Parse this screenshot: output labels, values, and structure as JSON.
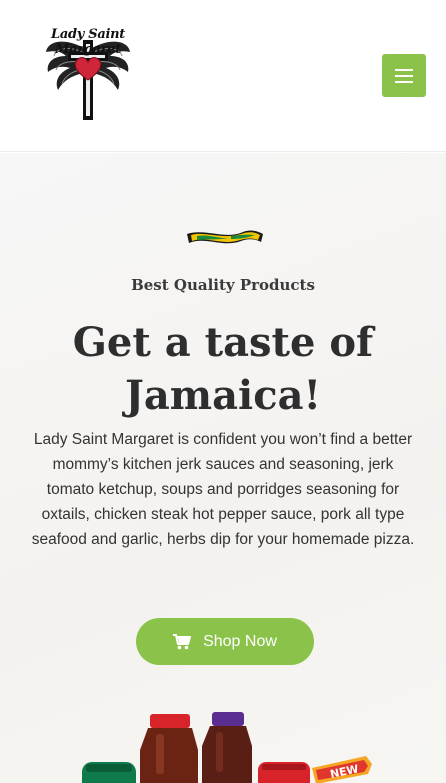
{
  "header": {
    "logo_text": "Lady Saint Margaret",
    "menu_icon": "hamburger-icon"
  },
  "hero": {
    "tagline": "Best Quality Products",
    "title_line1": "Get a taste of",
    "title_line2": "Jamaica!",
    "description": "Lady Saint Margaret is confident you won’t find a better mommy’s kitchen jerk sauces and seasoning, jerk tomato ketchup, soups and porridges seasoning for oxtails, chicken steak hot pepper sauce, pork all type seafood and garlic, herbs dip for your homemade pizza.",
    "cta_label": "Shop Now",
    "cta_icon": "shopping-cart-icon",
    "badge_text": "NEW"
  },
  "colors": {
    "accent": "#8bc34a",
    "text_dark": "#2e2e2e"
  }
}
